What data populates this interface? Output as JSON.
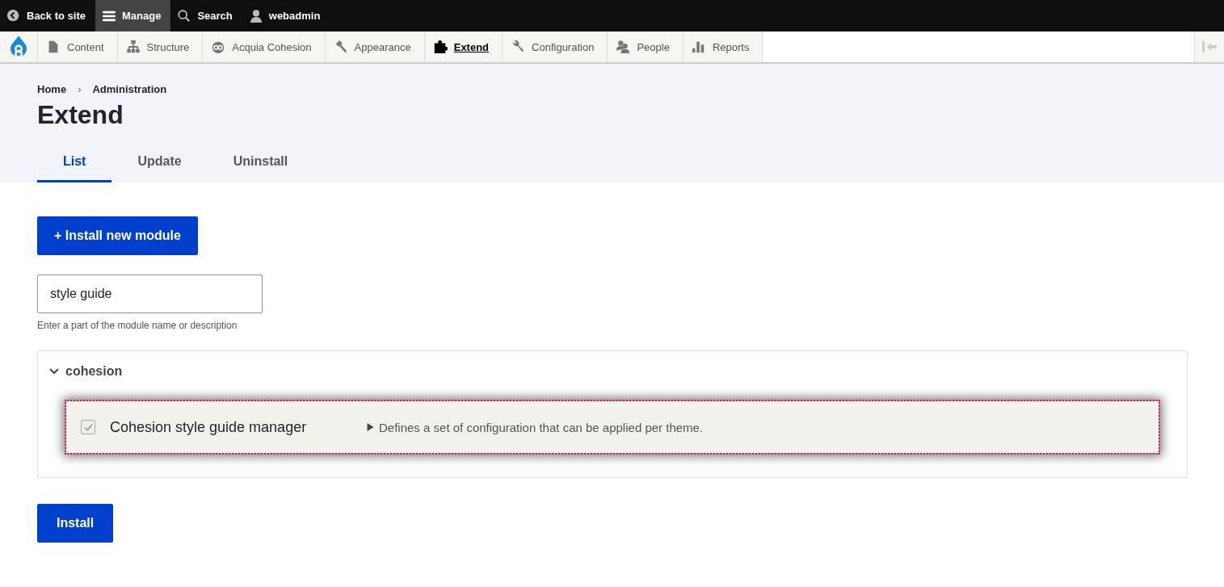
{
  "toolbar": [
    {
      "label": "Back to site",
      "kind": "back",
      "selected": false
    },
    {
      "label": "Manage",
      "kind": "menu",
      "selected": true
    },
    {
      "label": "Search",
      "kind": "search",
      "selected": false
    },
    {
      "label": "webadmin",
      "kind": "user",
      "selected": false
    }
  ],
  "tray": [
    {
      "label": "Content",
      "kind": "page",
      "selected": false
    },
    {
      "label": "Structure",
      "kind": "tree",
      "selected": false
    },
    {
      "label": "Acquia Cohesion",
      "kind": "drop",
      "selected": false
    },
    {
      "label": "Appearance",
      "kind": "hammer",
      "selected": false
    },
    {
      "label": "Extend",
      "kind": "puzzle",
      "selected": true
    },
    {
      "label": "Configuration",
      "kind": "wrench",
      "selected": false
    },
    {
      "label": "People",
      "kind": "people",
      "selected": false
    },
    {
      "label": "Reports",
      "kind": "bars",
      "selected": false
    }
  ],
  "breadcrumb": [
    "Home",
    "Administration"
  ],
  "breadcrumb_separator": "›",
  "title": "Extend",
  "tabs": [
    {
      "label": "List",
      "selected": true
    },
    {
      "label": "Update",
      "selected": false
    },
    {
      "label": "Uninstall",
      "selected": false
    }
  ],
  "install_new_button": "+ Install new module",
  "filter": {
    "value": "style guide",
    "description": "Enter a part of the module name or description"
  },
  "group": {
    "name": "cohesion",
    "expanded": true,
    "modules": [
      {
        "name": "Cohesion style guide manager",
        "description": "Defines a set of configuration that can be applied per theme.",
        "checked": true,
        "disabled": true,
        "focused": true
      }
    ]
  },
  "install_button": "Install"
}
